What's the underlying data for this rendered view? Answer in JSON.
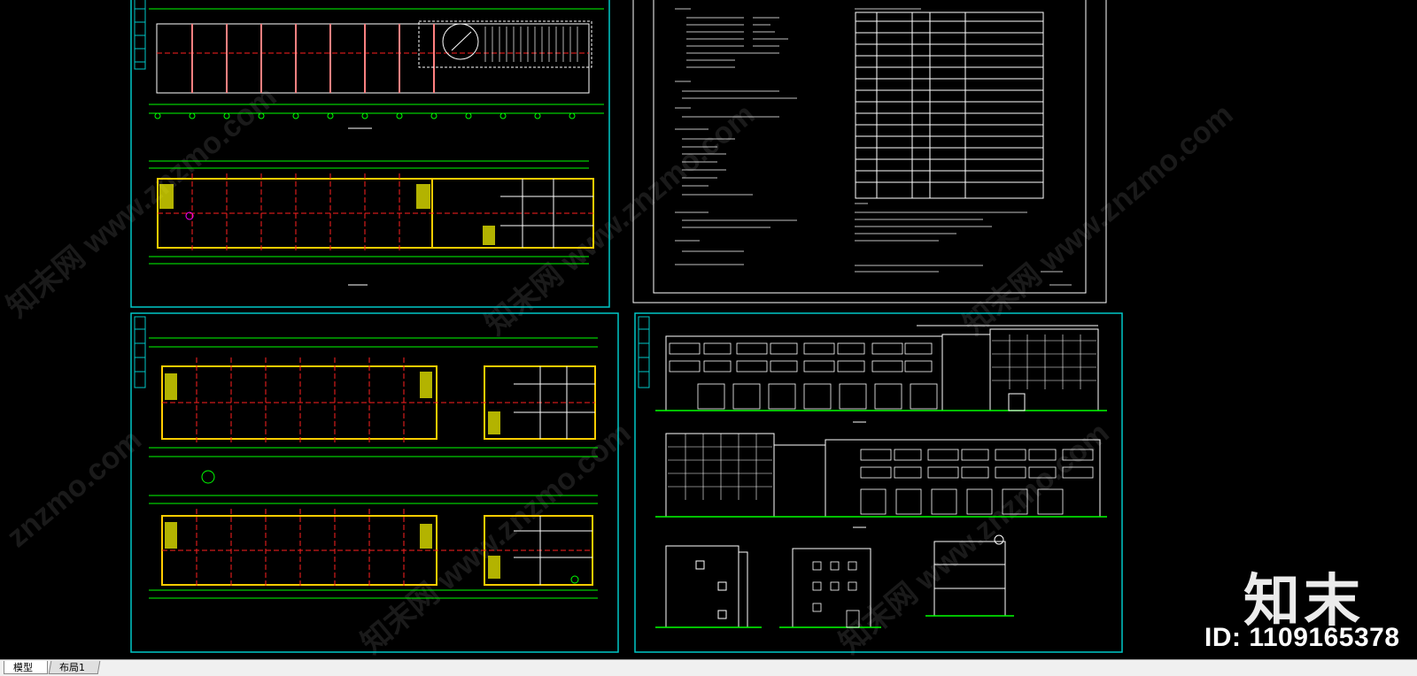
{
  "workspace": {
    "background": "#000000",
    "line_colors": {
      "frame": "#00c8c8",
      "dimension": "#00ff00",
      "wall": "#ffcc00",
      "axis": "#ff2020",
      "stair": "#ffff00",
      "door": "#ff00ff",
      "text": "#ffffff"
    }
  },
  "watermark": {
    "logo": "知末",
    "id_label": "ID: 1109165378"
  },
  "tabs": [
    {
      "label": "模型",
      "active": true
    },
    {
      "label": "布局1",
      "active": false
    }
  ],
  "sheets": [
    {
      "name": "floor-plans-sheet-top"
    },
    {
      "name": "design-notes-sheet"
    },
    {
      "name": "floor-plans-sheet-bottom"
    },
    {
      "name": "elevations-sheet"
    }
  ]
}
